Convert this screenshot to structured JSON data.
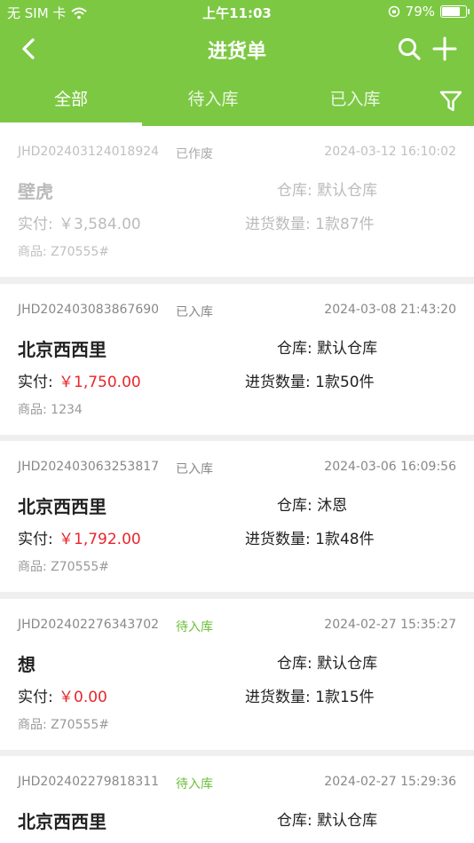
{
  "status_bar": {
    "carrier": "无 SIM 卡",
    "time": "上午11:03",
    "battery": "79%"
  },
  "nav": {
    "title": "进货单"
  },
  "tabs": [
    {
      "label": "全部",
      "active": true
    },
    {
      "label": "待入库",
      "active": false
    },
    {
      "label": "已入库",
      "active": false
    }
  ],
  "labels": {
    "warehouse_prefix": "仓库:",
    "paid_prefix": "实付:",
    "qty_prefix": "进货数量:",
    "goods_prefix": "商品:"
  },
  "orders": [
    {
      "order_no": "JHD202403124018924",
      "status": "已作废",
      "datetime": "2024-03-12 16:10:02",
      "supplier": "壁虎",
      "warehouse": "仓库: 默认仓库",
      "paid_label": "实付:",
      "paid": "￥3,584.00",
      "qty": "进货数量: 1款87件",
      "goods": "商品: Z70555#"
    },
    {
      "order_no": "JHD202403083867690",
      "status": "已入库",
      "datetime": "2024-03-08 21:43:20",
      "supplier": "北京西西里",
      "warehouse": "仓库: 默认仓库",
      "paid_label": "实付:",
      "paid": "￥1,750.00",
      "qty": "进货数量: 1款50件",
      "goods": "商品: 1234"
    },
    {
      "order_no": "JHD202403063253817",
      "status": "已入库",
      "datetime": "2024-03-06 16:09:56",
      "supplier": "北京西西里",
      "warehouse": "仓库: 沐恩",
      "paid_label": "实付:",
      "paid": "￥1,792.00",
      "qty": "进货数量: 1款48件",
      "goods": "商品: Z70555#"
    },
    {
      "order_no": "JHD202402276343702",
      "status": "待入库",
      "datetime": "2024-02-27 15:35:27",
      "supplier": "想",
      "warehouse": "仓库: 默认仓库",
      "paid_label": "实付:",
      "paid": "￥0.00",
      "qty": "进货数量: 1款15件",
      "goods": "商品: Z70555#"
    },
    {
      "order_no": "JHD202402279818311",
      "status": "待入库",
      "datetime": "2024-02-27 15:29:36",
      "supplier": "北京西西里",
      "warehouse": "仓库: 默认仓库"
    }
  ],
  "colors": {
    "brand_green": "#7cc843",
    "amount_red": "#e8262b",
    "pending_green": "#6cbf3c"
  }
}
